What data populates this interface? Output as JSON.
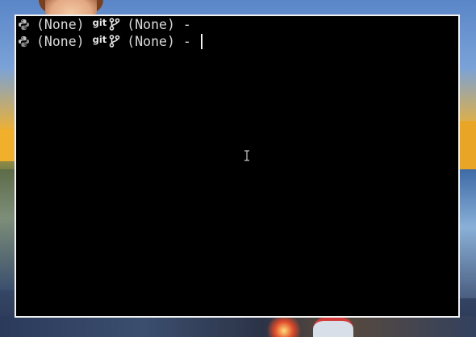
{
  "terminal": {
    "lines": [
      {
        "python_env": "(None)",
        "git_label": "git",
        "git_branch": "(None)",
        "suffix": "-"
      },
      {
        "python_env": "(None)",
        "git_label": "git",
        "git_branch": "(None)",
        "suffix": "-"
      }
    ],
    "icons": {
      "python": "python-icon",
      "branch": "git-branch-icon",
      "pointer": "i-beam-cursor-icon"
    },
    "colors": {
      "background": "#000000",
      "text": "#d8d8d8",
      "border": "#f2f2f2"
    }
  }
}
